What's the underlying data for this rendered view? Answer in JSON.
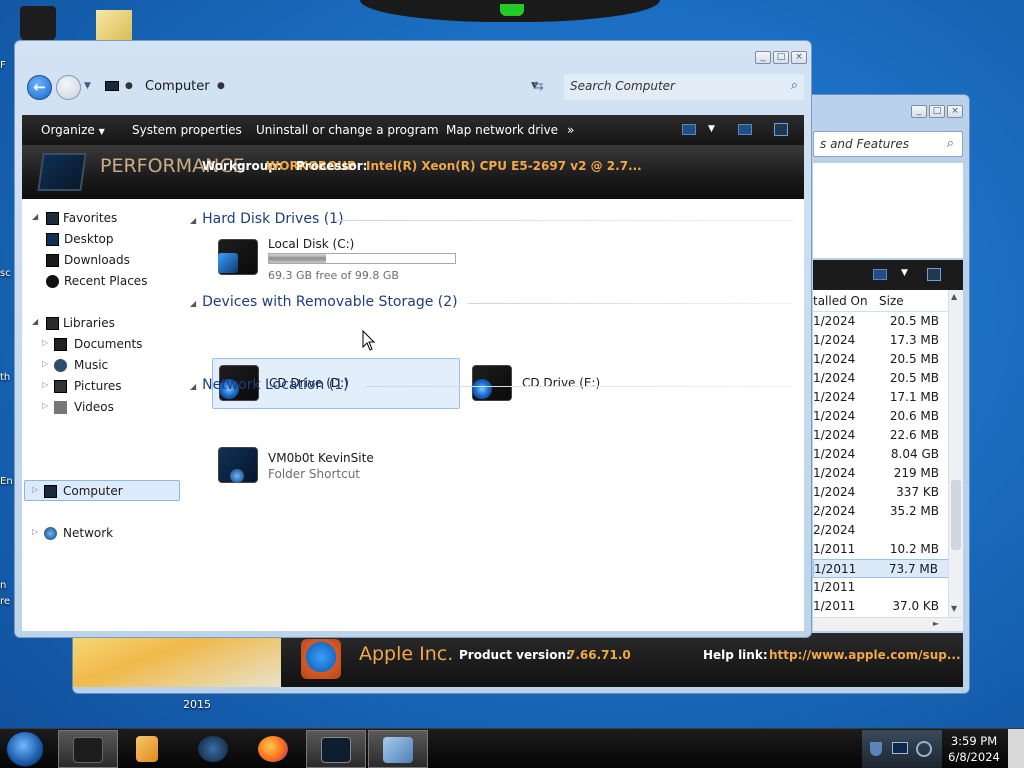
{
  "desktop": {
    "year_label": "2015",
    "edge_texts": [
      "F",
      "sc",
      "th",
      "En",
      "n",
      "re"
    ]
  },
  "back_window": {
    "search_placeholder": "s and Features",
    "column_installed": "talled On",
    "column_size": "Size",
    "rows": [
      {
        "date": "1/2024",
        "size": "20.5 MB"
      },
      {
        "date": "1/2024",
        "size": "17.3 MB"
      },
      {
        "date": "1/2024",
        "size": "20.5 MB"
      },
      {
        "date": "1/2024",
        "size": "20.5 MB"
      },
      {
        "date": "1/2024",
        "size": "17.1 MB"
      },
      {
        "date": "1/2024",
        "size": "20.6 MB"
      },
      {
        "date": "1/2024",
        "size": "22.6 MB"
      },
      {
        "date": "1/2024",
        "size": "8.04 GB"
      },
      {
        "date": "1/2024",
        "size": "219 MB"
      },
      {
        "date": "1/2024",
        "size": "337 KB"
      },
      {
        "date": "2/2024",
        "size": "35.2 MB"
      },
      {
        "date": "2/2024",
        "size": ""
      },
      {
        "date": "1/2011",
        "size": "10.2 MB"
      },
      {
        "date": "1/2011",
        "size": "73.7 MB"
      },
      {
        "date": "1/2011",
        "size": ""
      },
      {
        "date": "1/2011",
        "size": "37.0 KB"
      }
    ],
    "selected_row": 13,
    "details": {
      "publisher": "Apple Inc.",
      "product_version_label": "Product version:",
      "product_version": "7.66.71.0",
      "help_link_label": "Help link:",
      "help_link": "http://www.apple.com/sup..."
    }
  },
  "explorer": {
    "address_crumb": "Computer",
    "search_placeholder": "Search Computer",
    "toolbar": {
      "organize": "Organize",
      "system_properties": "System properties",
      "uninstall": "Uninstall or change a program",
      "map_drive": "Map network drive",
      "more": "»"
    },
    "details": {
      "perf_text": "PERFORMANCE",
      "workgroup_label": "Workgroup:",
      "workgroup_value": "WORKGROUP",
      "processor_label": "Processor:",
      "processor_value": "Intel(R) Xeon(R) CPU E5-2697 v2 @ 2.7..."
    },
    "nav": {
      "favorites": "Favorites",
      "desktop": "Desktop",
      "downloads": "Downloads",
      "recent": "Recent Places",
      "libraries": "Libraries",
      "documents": "Documents",
      "music": "Music",
      "pictures": "Pictures",
      "videos": "Videos",
      "computer": "Computer",
      "network": "Network"
    },
    "groups": {
      "hdd": "Hard Disk Drives (1)",
      "removable": "Devices with Removable Storage (2)",
      "network": "Network Location (1)"
    },
    "local_disk": {
      "name": "Local Disk (C:)",
      "free": "69.3 GB free of 99.8 GB",
      "used_fraction": 0.306
    },
    "cd_d": "CD Drive (D:)",
    "cd_e": "CD Drive (E:)",
    "net_loc": {
      "name": "VM0b0t KevinSite",
      "type": "Folder Shortcut"
    }
  },
  "taskbar": {
    "time": "3:59 PM",
    "date": "6/8/2024"
  },
  "colors": {
    "accent_orange": "#f0a84a",
    "group_header": "#1e3d80",
    "selection": "#dcebfc"
  }
}
